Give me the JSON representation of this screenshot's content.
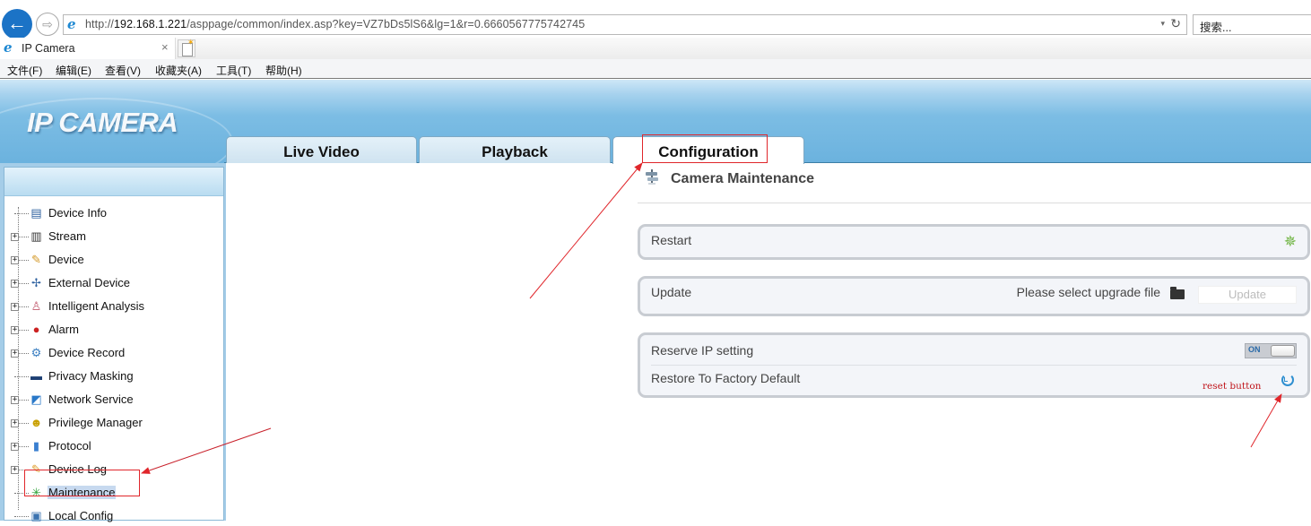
{
  "browser": {
    "url_prefix": "http://",
    "url_host": "192.168.1.221",
    "url_path": "/asppage/common/index.asp?key=VZ7bDs5lS6&lg=1&r=0.6660567775742745",
    "search_placeholder": "搜索...",
    "tab_title": "IP Camera",
    "tab_close": "×",
    "back_icon": "←",
    "forward_icon": "⇨",
    "refresh_icon": "↻",
    "dropdown_icon": "▾",
    "menu": [
      {
        "label": "文件(F)"
      },
      {
        "label": "编辑(E)"
      },
      {
        "label": "查看(V)"
      },
      {
        "label": "收藏夹(A)"
      },
      {
        "label": "工具(T)"
      },
      {
        "label": "帮助(H)"
      }
    ]
  },
  "app": {
    "logo": "IP CAMERA",
    "nav_tabs": [
      {
        "label": "Live Video",
        "active": false
      },
      {
        "label": "Playback",
        "active": false
      },
      {
        "label": "Configuration",
        "active": true
      }
    ]
  },
  "sidebar": {
    "items": [
      {
        "label": "Device Info",
        "expandable": false,
        "icon": "document-list-icon",
        "glyph": "▤",
        "color": "#2c5f9e"
      },
      {
        "label": "Stream",
        "expandable": true,
        "icon": "stream-icon",
        "glyph": "▥",
        "color": "#333"
      },
      {
        "label": "Device",
        "expandable": true,
        "icon": "device-settings-icon",
        "glyph": "✎",
        "color": "#d49a2a"
      },
      {
        "label": "External Device",
        "expandable": true,
        "icon": "external-device-icon",
        "glyph": "✢",
        "color": "#2c5f9e"
      },
      {
        "label": "Intelligent Analysis",
        "expandable": true,
        "icon": "person-analysis-icon",
        "glyph": "♙",
        "color": "#c25b6e"
      },
      {
        "label": "Alarm",
        "expandable": true,
        "icon": "alarm-icon",
        "glyph": "●",
        "color": "#cc2222"
      },
      {
        "label": "Device Record",
        "expandable": true,
        "icon": "record-icon",
        "glyph": "⚙",
        "color": "#3b7fc1"
      },
      {
        "label": "Privacy Masking",
        "expandable": false,
        "icon": "privacy-mask-icon",
        "glyph": "▬",
        "color": "#1d3f73"
      },
      {
        "label": "Network Service",
        "expandable": true,
        "icon": "network-icon",
        "glyph": "◩",
        "color": "#2a78c8"
      },
      {
        "label": "Privilege Manager",
        "expandable": true,
        "icon": "user-key-icon",
        "glyph": "☻",
        "color": "#c9a000"
      },
      {
        "label": "Protocol",
        "expandable": true,
        "icon": "protocol-icon",
        "glyph": "▮",
        "color": "#3a7fd0"
      },
      {
        "label": "Device Log",
        "expandable": true,
        "icon": "log-icon",
        "glyph": "✎",
        "color": "#e0a030"
      },
      {
        "label": "Maintenance",
        "expandable": false,
        "icon": "maintenance-icon",
        "glyph": "✳",
        "color": "#2fa33a",
        "selected": true
      },
      {
        "label": "Local Config",
        "expandable": false,
        "icon": "local-config-icon",
        "glyph": "▣",
        "color": "#3b73b0"
      }
    ]
  },
  "main": {
    "title": "Camera Maintenance",
    "restart": {
      "label": "Restart"
    },
    "update": {
      "label": "Update",
      "file_prompt": "Please select upgrade file",
      "button": "Update"
    },
    "reserve_ip": {
      "label": "Reserve IP setting",
      "toggle_text": "ON",
      "enabled": true
    },
    "factory_default": {
      "label": "Restore To Factory Default"
    }
  },
  "annotations": {
    "reset_note": "reset button",
    "color": "#e0262b"
  }
}
